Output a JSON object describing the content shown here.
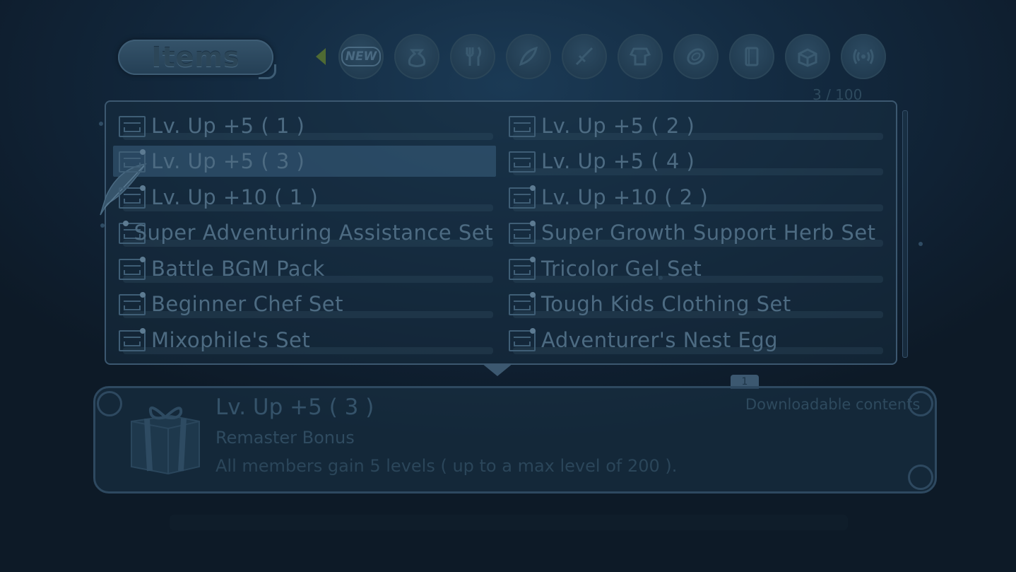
{
  "header": {
    "title": "Items",
    "tabs": [
      {
        "name": "new-tab",
        "label": "NEW",
        "icon": "new-badge-icon"
      },
      {
        "name": "tab-consumables",
        "icon": "bag-icon"
      },
      {
        "name": "tab-food",
        "icon": "fork-knife-icon"
      },
      {
        "name": "tab-materials",
        "icon": "leaf-icon"
      },
      {
        "name": "tab-weapons",
        "icon": "sword-icon"
      },
      {
        "name": "tab-armor",
        "icon": "armor-icon"
      },
      {
        "name": "tab-accessories",
        "icon": "ring-icon"
      },
      {
        "name": "tab-key-items",
        "icon": "book-icon"
      },
      {
        "name": "tab-dlc",
        "icon": "chest-icon"
      },
      {
        "name": "tab-all",
        "icon": "sound-waves-icon"
      }
    ],
    "count": "3 / 100"
  },
  "list": {
    "items": [
      {
        "label": "Lv. Up +5 ( 1 )",
        "new": false,
        "selected": false
      },
      {
        "label": "Lv. Up +5 ( 2 )",
        "new": false,
        "selected": false
      },
      {
        "label": "Lv. Up +5 ( 3 )",
        "new": true,
        "selected": true
      },
      {
        "label": "Lv. Up +5 ( 4 )",
        "new": false,
        "selected": false
      },
      {
        "label": "Lv. Up +10 ( 1 )",
        "new": true,
        "selected": false
      },
      {
        "label": "Lv. Up +10 ( 2 )",
        "new": true,
        "selected": false
      },
      {
        "label": "Super Adventuring Assistance Set",
        "new": true,
        "selected": false
      },
      {
        "label": "Super Growth Support Herb Set",
        "new": true,
        "selected": false
      },
      {
        "label": "Battle BGM Pack",
        "new": true,
        "selected": false
      },
      {
        "label": "Tricolor Gel Set",
        "new": true,
        "selected": false
      },
      {
        "label": "Beginner Chef Set",
        "new": true,
        "selected": false
      },
      {
        "label": "Tough Kids Clothing Set",
        "new": true,
        "selected": false
      },
      {
        "label": "Mixophile's Set",
        "new": true,
        "selected": false
      },
      {
        "label": "Adventurer's Nest Egg",
        "new": true,
        "selected": false
      }
    ]
  },
  "detail": {
    "quantity": "1",
    "name": "Lv. Up +5 ( 3 )",
    "subtitle": "Remaster Bonus",
    "description": "All members gain 5 levels ( up to a max level of 200 ).",
    "category": "Downloadable contents",
    "icon": "gift-box-icon"
  }
}
